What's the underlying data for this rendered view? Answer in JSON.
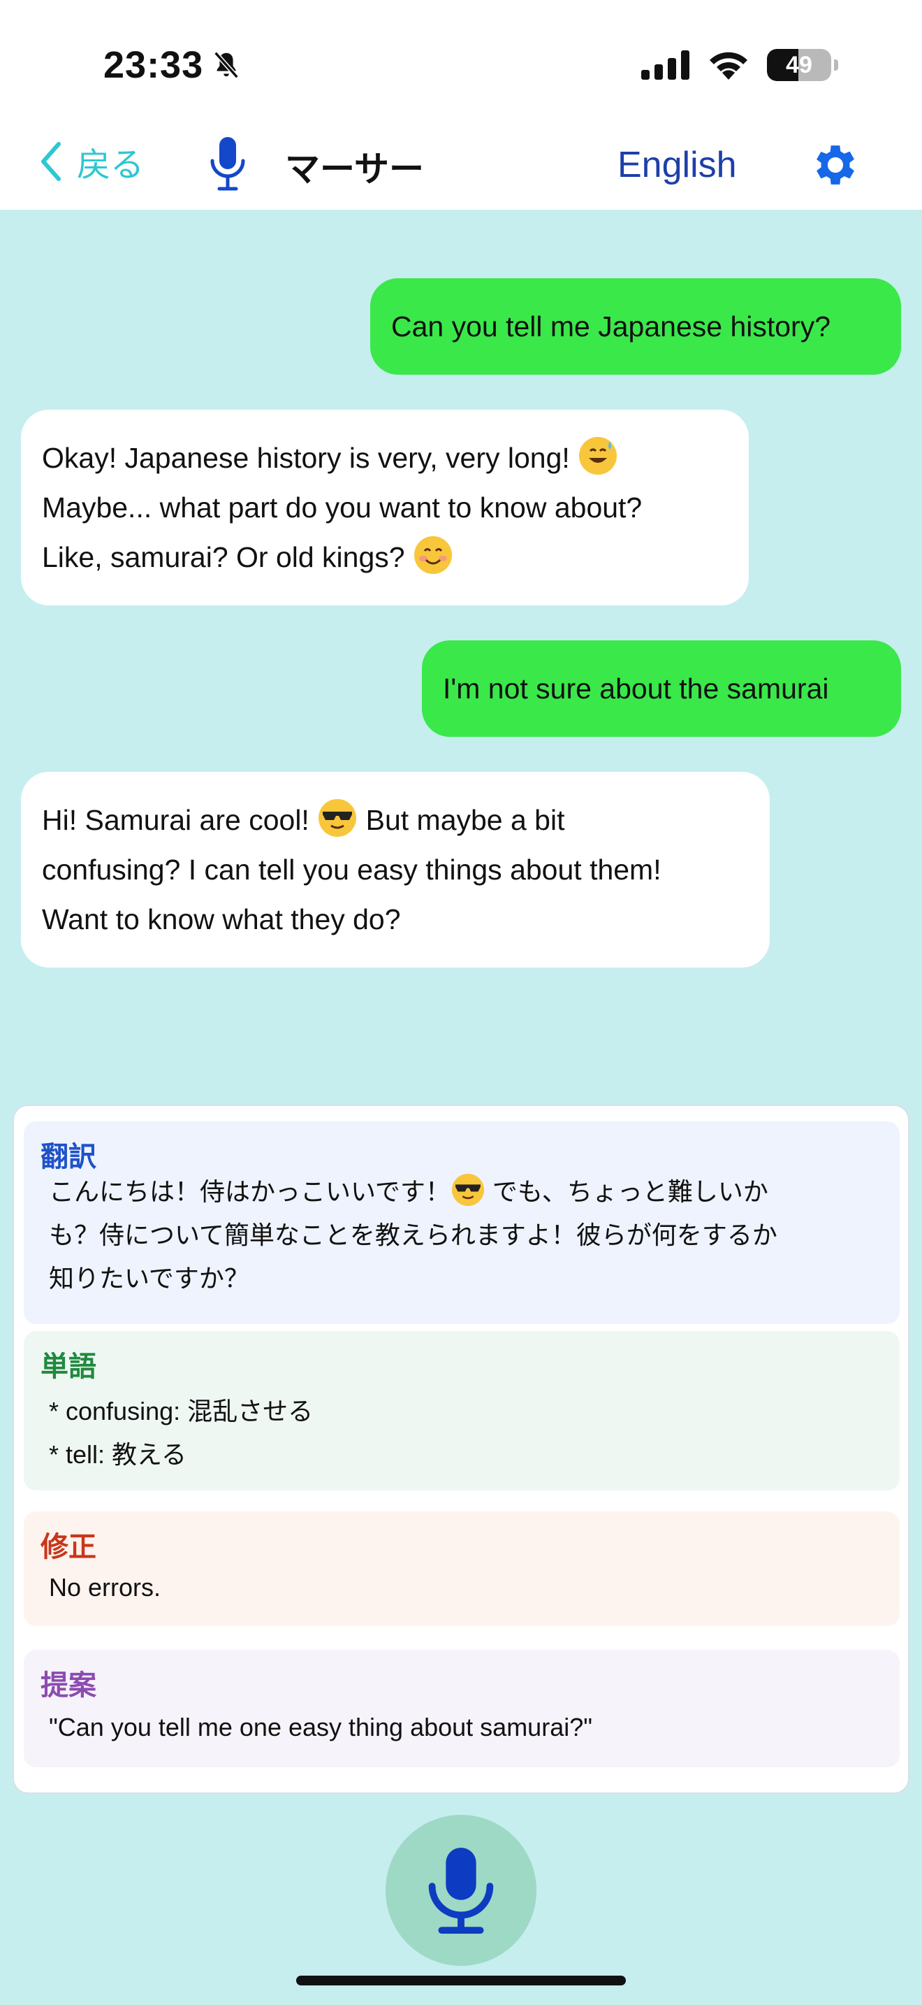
{
  "status_bar": {
    "time": "23:33",
    "battery": "49",
    "battery_level": 0.49
  },
  "nav": {
    "back_label": "戻る",
    "title": "マーサー",
    "language": "English"
  },
  "messages": [
    {
      "role": "user",
      "lines": [
        "Can you tell me Japanese history?"
      ]
    },
    {
      "role": "bot",
      "lines": [
        "Okay! Japanese history is very, very long! ",
        "Maybe... what part do you want to know about?",
        "Like, samurai? Or old kings? "
      ]
    },
    {
      "role": "user",
      "lines": [
        "I'm not sure about the samurai"
      ]
    },
    {
      "role": "bot",
      "lines": [
        "Hi! Samurai are cool! ",
        " But maybe a bit",
        "confusing? I can tell you easy things about them!",
        "Want to know what they do?"
      ]
    }
  ],
  "panel": {
    "translation": {
      "title": "翻訳",
      "line1a": "こんにちは！侍はかっこいいです！",
      "line1b": " でも、ちょっと難しいか",
      "line2": "も？侍について簡単なことを教えられますよ！彼らが何をするか",
      "line3": "知りたいですか？"
    },
    "vocab": {
      "title": "単語",
      "items": [
        "* confusing: 混乱させる",
        "* tell: 教える"
      ]
    },
    "correction": {
      "title": "修正",
      "text": "No errors."
    },
    "suggestion": {
      "title": "提案",
      "text": "\"Can you tell me one easy thing about samurai?\""
    }
  },
  "icons": {
    "back": "chevron-left-icon",
    "nav_mic": "microphone-icon",
    "settings": "gear-icon",
    "bell": "bell-slash-icon",
    "signal": "cellular-signal-icon",
    "wifi": "wifi-icon",
    "fab": "microphone-icon"
  },
  "colors": {
    "accent_cyan": "#2ec7d3",
    "nav_blue": "#1d3fa8",
    "user_bubble": "#3ae84a",
    "background": "#c6eeee"
  }
}
